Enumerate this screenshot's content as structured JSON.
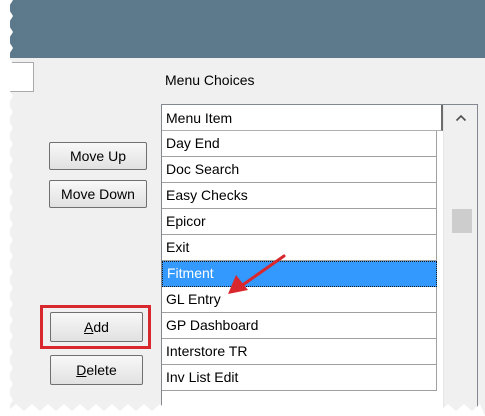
{
  "menu_choices": {
    "label": "Menu Choices",
    "column_header": "Menu Item",
    "items": [
      "Day End",
      "Doc Search",
      "Easy Checks",
      "Epicor",
      "Exit",
      "Fitment",
      "GL Entry",
      "GP Dashboard",
      "Interstore TR",
      "Inv List Edit"
    ],
    "selected_item": "Fitment"
  },
  "buttons": {
    "move_up": "Move Up",
    "move_down": "Move Down",
    "add_accel": "A",
    "add_rest": "dd",
    "delete_accel": "D",
    "delete_rest": "elete"
  },
  "colors": {
    "titlebar": "#5c7a8c",
    "selection": "#3399ff",
    "callout": "#d9272e"
  },
  "icons": {
    "scroll_up": "chevron-up-icon",
    "callout_arrow": "arrow-icon"
  }
}
